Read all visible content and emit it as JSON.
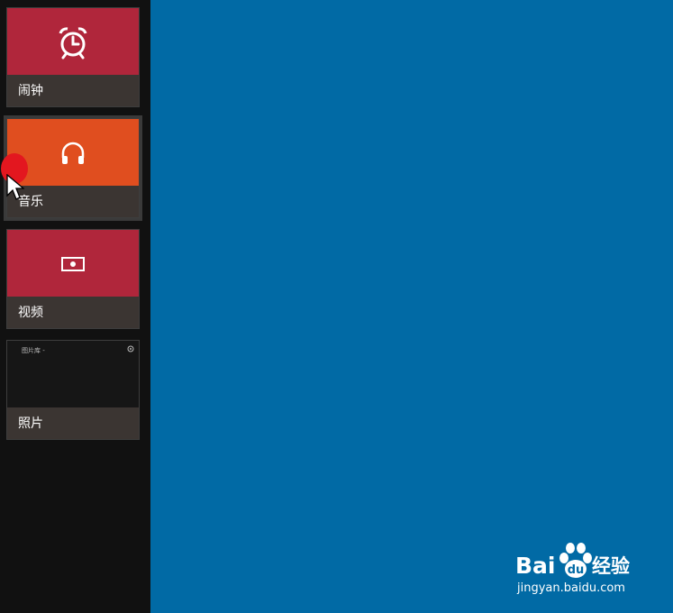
{
  "tiles": [
    {
      "label": "闹钟",
      "icon": "alarm-clock-icon",
      "color": "#b0263b"
    },
    {
      "label": "音乐",
      "icon": "headphones-icon",
      "color": "#e04e1f"
    },
    {
      "label": "视频",
      "icon": "video-icon",
      "color": "#b0263b"
    },
    {
      "label": "照片",
      "icon": "photo-icon",
      "color": "#161616",
      "caption": "图片库 -"
    }
  ],
  "colors": {
    "desktop": "#016aa5",
    "sidebar": "#111111",
    "tile_footer": "#3b3532",
    "cursor_highlight": "#e3171f"
  },
  "watermark": {
    "brand": "Bai",
    "brand_suffix": "经验",
    "url": "jingyan.baidu.com"
  }
}
